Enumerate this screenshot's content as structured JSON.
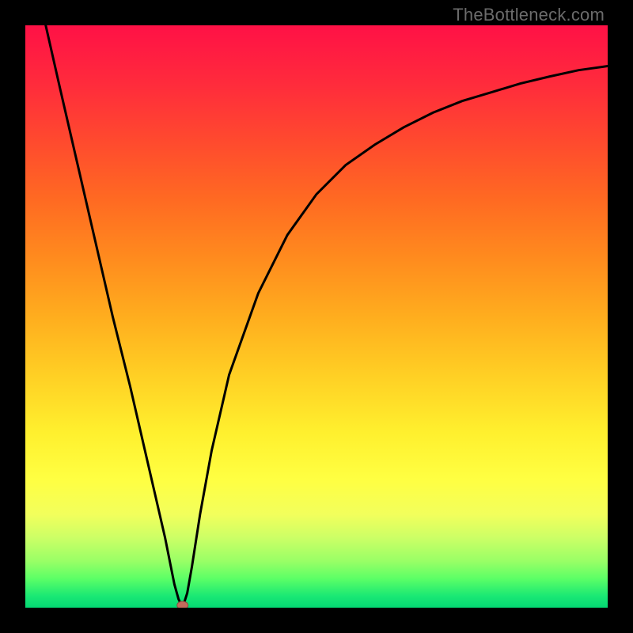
{
  "watermark": {
    "text": "TheBottleneck.com"
  },
  "colors": {
    "frame": "#000000",
    "curve": "#000000",
    "dot_fill": "#c46a5c",
    "dot_stroke": "#8d4a40"
  },
  "gradient_stops": [
    {
      "offset": 0.0,
      "color": "#ff1146"
    },
    {
      "offset": 0.1,
      "color": "#ff2b3c"
    },
    {
      "offset": 0.2,
      "color": "#ff4a2e"
    },
    {
      "offset": 0.3,
      "color": "#ff6a22"
    },
    {
      "offset": 0.4,
      "color": "#ff8b1e"
    },
    {
      "offset": 0.5,
      "color": "#ffad1e"
    },
    {
      "offset": 0.6,
      "color": "#ffcf24"
    },
    {
      "offset": 0.7,
      "color": "#fff02e"
    },
    {
      "offset": 0.78,
      "color": "#ffff42"
    },
    {
      "offset": 0.84,
      "color": "#f2ff5c"
    },
    {
      "offset": 0.88,
      "color": "#ccff66"
    },
    {
      "offset": 0.92,
      "color": "#99ff66"
    },
    {
      "offset": 0.95,
      "color": "#5cff66"
    },
    {
      "offset": 0.98,
      "color": "#1ae874"
    },
    {
      "offset": 1.0,
      "color": "#04d873"
    }
  ],
  "chart_data": {
    "type": "line",
    "title": "",
    "xlabel": "",
    "ylabel": "",
    "xlim": [
      0,
      100
    ],
    "ylim": [
      0,
      100
    ],
    "series": [
      {
        "name": "left-branch",
        "x": [
          3.5,
          6,
          9,
          12,
          15,
          18,
          21,
          24,
          25.6,
          26.3,
          27.0
        ],
        "y": [
          100,
          89,
          76,
          63,
          50,
          38,
          25,
          12,
          4,
          1.5,
          0
        ]
      },
      {
        "name": "right-branch",
        "x": [
          27.0,
          27.8,
          28.6,
          30,
          32,
          35,
          40,
          45,
          50,
          55,
          60,
          65,
          70,
          75,
          80,
          85,
          90,
          95,
          100
        ],
        "y": [
          0,
          2.5,
          7,
          16,
          27,
          40,
          54,
          64,
          71,
          76,
          79.5,
          82.5,
          85,
          87,
          88.5,
          90,
          91.2,
          92.3,
          93
        ]
      }
    ],
    "marker": {
      "name": "minimum-point",
      "x": 27.0,
      "y": 0
    }
  }
}
